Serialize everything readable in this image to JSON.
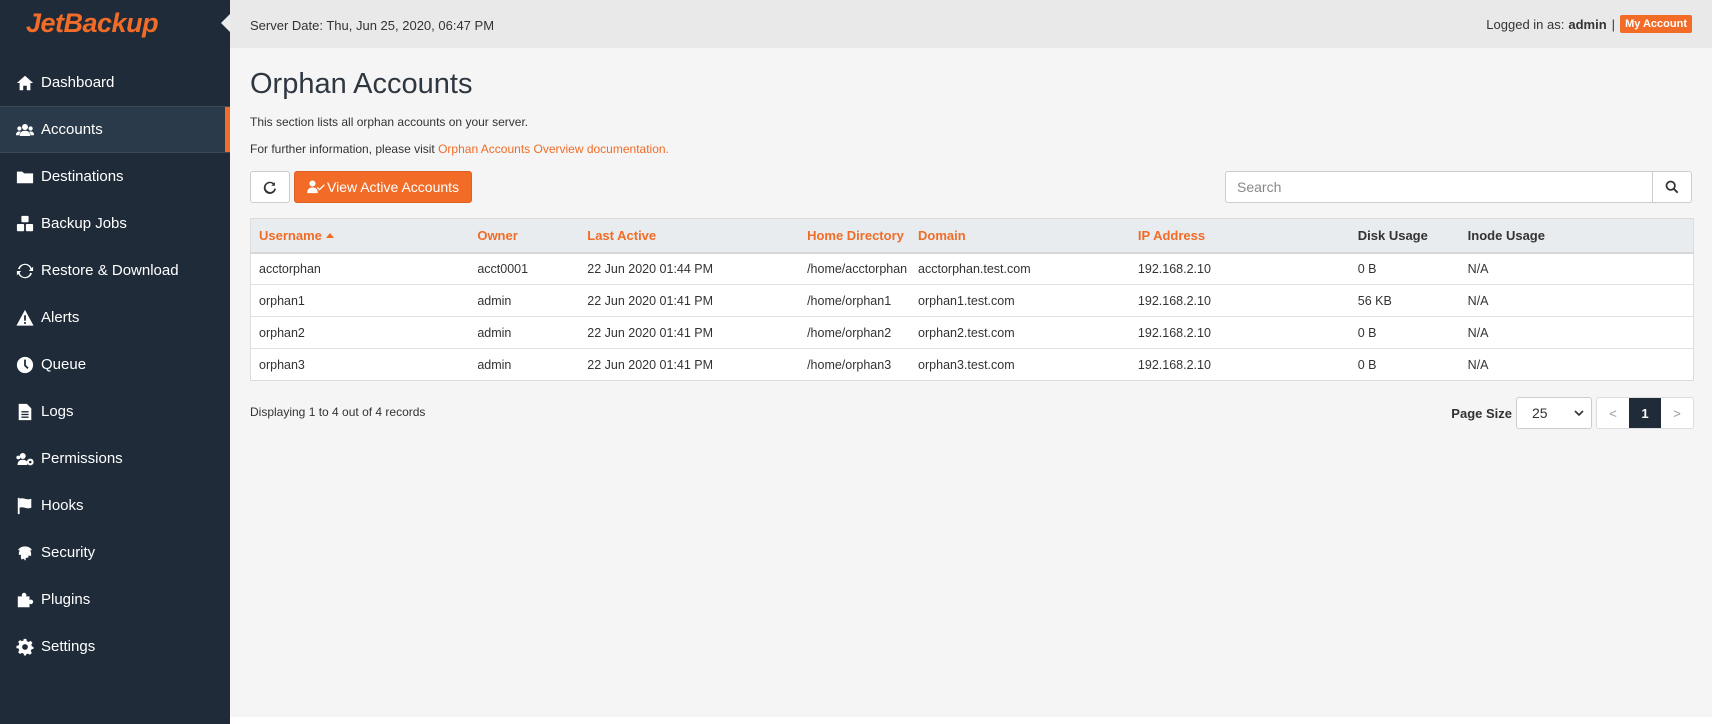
{
  "brand": {
    "logo_text": "JetBackup",
    "accent": "#f26c27"
  },
  "sidebar": {
    "items": [
      {
        "label": "Dashboard",
        "icon": "home-icon"
      },
      {
        "label": "Accounts",
        "icon": "users-icon",
        "active": true
      },
      {
        "label": "Destinations",
        "icon": "folder-icon"
      },
      {
        "label": "Backup Jobs",
        "icon": "cubes-icon"
      },
      {
        "label": "Restore & Download",
        "icon": "sync-icon"
      },
      {
        "label": "Alerts",
        "icon": "warning-icon"
      },
      {
        "label": "Queue",
        "icon": "clock-icon"
      },
      {
        "label": "Logs",
        "icon": "file-icon"
      },
      {
        "label": "Permissions",
        "icon": "users-cog-icon"
      },
      {
        "label": "Hooks",
        "icon": "flag-icon"
      },
      {
        "label": "Security",
        "icon": "fingerprint-icon"
      },
      {
        "label": "Plugins",
        "icon": "puzzle-icon"
      },
      {
        "label": "Settings",
        "icon": "gear-icon"
      }
    ]
  },
  "topbar": {
    "server_date": "Server Date: Thu, Jun 25, 2020, 06:47 PM",
    "logged_in_label": "Logged in as:",
    "username": "admin",
    "separator": "|",
    "my_account": "My Account"
  },
  "page": {
    "title": "Orphan Accounts",
    "description": "This section lists all orphan accounts on your server.",
    "info_prefix": "For further information, please visit",
    "info_link": "Orphan Accounts Overview documentation."
  },
  "toolbar": {
    "view_active_label": "View Active Accounts",
    "search_placeholder": "Search"
  },
  "table": {
    "columns": [
      "Username",
      "Owner",
      "Last Active",
      "Home Directory",
      "Domain",
      "IP Address",
      "Disk Usage",
      "Inode Usage"
    ],
    "rows": [
      [
        "acctorphan",
        "acct0001",
        "22 Jun 2020 01:44 PM",
        "/home/acctorphan",
        "acctorphan.test.com",
        "192.168.2.10",
        "0 B",
        "N/A"
      ],
      [
        "orphan1",
        "admin",
        "22 Jun 2020 01:41 PM",
        "/home/orphan1",
        "orphan1.test.com",
        "192.168.2.10",
        "56 KB",
        "N/A"
      ],
      [
        "orphan2",
        "admin",
        "22 Jun 2020 01:41 PM",
        "/home/orphan2",
        "orphan2.test.com",
        "192.168.2.10",
        "0 B",
        "N/A"
      ],
      [
        "orphan3",
        "admin",
        "22 Jun 2020 01:41 PM",
        "/home/orphan3",
        "orphan3.test.com",
        "192.168.2.10",
        "0 B",
        "N/A"
      ]
    ]
  },
  "footer": {
    "records_text": "Displaying 1 to 4 out of 4 records",
    "page_size_label": "Page Size",
    "page_size_value": "25",
    "prev": "<",
    "current_page": "1",
    "next": ">"
  }
}
